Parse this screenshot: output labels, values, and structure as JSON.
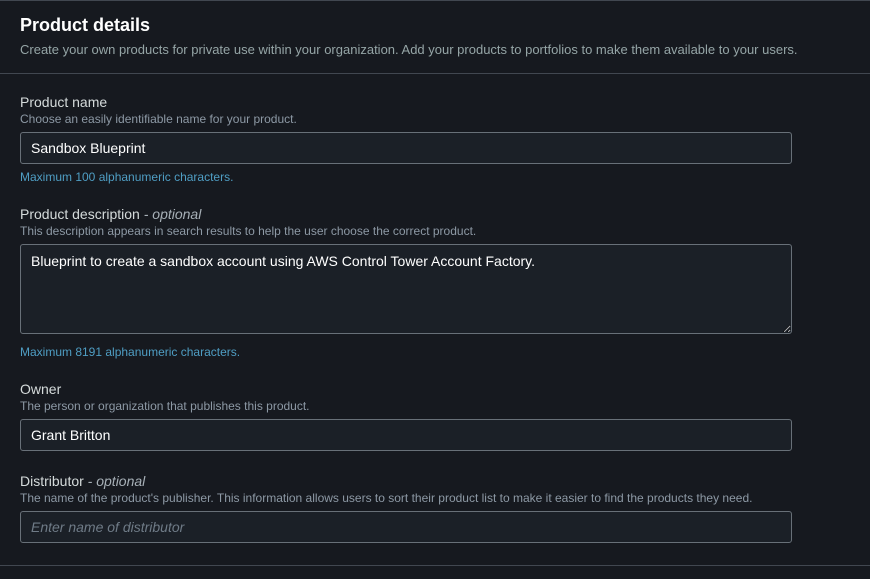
{
  "header": {
    "title": "Product details",
    "subtitle": "Create your own products for private use within your organization. Add your products to portfolios to make them available to your users."
  },
  "fields": {
    "product_name": {
      "label": "Product name",
      "hint": "Choose an easily identifiable name for your product.",
      "value": "Sandbox Blueprint",
      "constraint": "Maximum 100 alphanumeric characters."
    },
    "product_description": {
      "label": "Product description",
      "optional_suffix": " - optional",
      "hint": "This description appears in search results to help the user choose the correct product.",
      "value": "Blueprint to create a sandbox account using AWS Control Tower Account Factory.",
      "constraint": "Maximum 8191 alphanumeric characters."
    },
    "owner": {
      "label": "Owner",
      "hint": "The person or organization that publishes this product.",
      "value": "Grant Britton"
    },
    "distributor": {
      "label": "Distributor",
      "optional_suffix": " - optional",
      "hint": "The name of the product's publisher. This information allows users to sort their product list to make it easier to find the products they need.",
      "placeholder": "Enter name of distributor",
      "value": ""
    }
  }
}
